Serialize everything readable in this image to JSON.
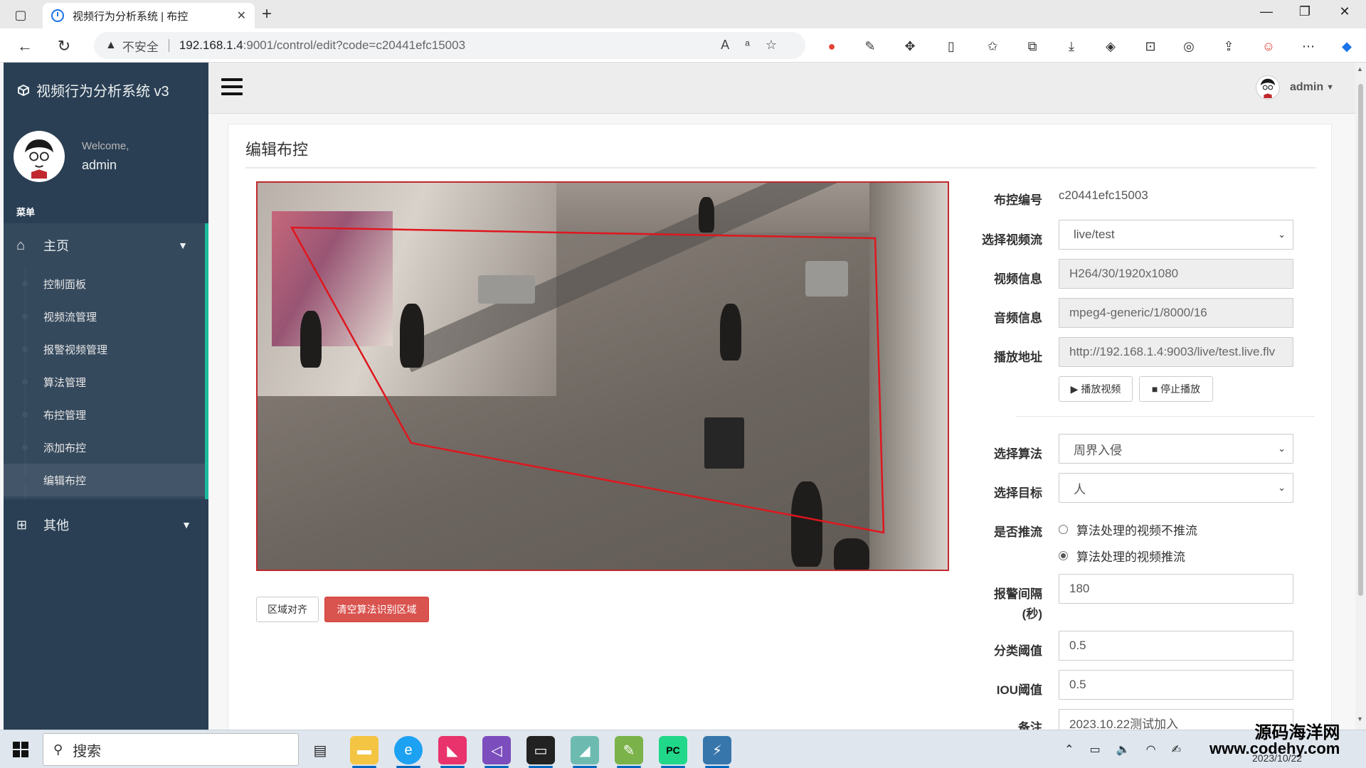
{
  "browser": {
    "tab_title": "视频行为分析系统 | 布控",
    "insecure_label": "不安全",
    "url_host": "192.168.1.4",
    "url_rest": ":9001/control/edit?code=c20441efc15003"
  },
  "sidebar": {
    "brand": "视频行为分析系统 v3",
    "welcome": "Welcome,",
    "username": "admin",
    "menu_heading": "菜单",
    "main_label": "主页",
    "items": [
      {
        "label": "控制面板"
      },
      {
        "label": "视频流管理"
      },
      {
        "label": "报警视频管理"
      },
      {
        "label": "算法管理"
      },
      {
        "label": "布控管理"
      },
      {
        "label": "添加布控"
      },
      {
        "label": "编辑布控"
      }
    ],
    "other_label": "其他"
  },
  "navbar": {
    "user": "admin"
  },
  "page": {
    "title": "编辑布控"
  },
  "video_buttons": {
    "align": "区域对齐",
    "clear": "清空算法识别区域"
  },
  "form": {
    "code_label": "布控编号",
    "code_value": "c20441efc15003",
    "stream_label": "选择视频流",
    "stream_value": "live/test",
    "video_info_label": "视频信息",
    "video_info_value": "H264/30/1920x1080",
    "audio_info_label": "音频信息",
    "audio_info_value": "mpeg4-generic/1/8000/16",
    "play_url_label": "播放地址",
    "play_url_value": "http://192.168.1.4:9003/live/test.live.flv",
    "play_btn": "▶ 播放视频",
    "stop_btn": "■ 停止播放",
    "algo_label": "选择算法",
    "algo_value": "周界入侵",
    "target_label": "选择目标",
    "target_value": "人",
    "push_label": "是否推流",
    "push_opt1": "算法处理的视频不推流",
    "push_opt2": "算法处理的视频推流",
    "interval_label_1": "报警间隔",
    "interval_label_2": "(秒)",
    "interval_value": "180",
    "cls_thr_label": "分类阈值",
    "cls_thr_value": "0.5",
    "iou_label": "IOU阈值",
    "iou_value": "0.5",
    "remark_label": "备注",
    "remark_value": "2023.10.22测试加入"
  },
  "taskbar": {
    "search": "搜索",
    "clock": "2023/10/22"
  },
  "watermark": {
    "line1": "源码海洋网",
    "line2": "www.codehy.com"
  },
  "colors": {
    "sidebar_bg": "#2a3f54",
    "accent": "#1abb9c",
    "danger": "#d9534f",
    "roi": "#e0161e"
  }
}
